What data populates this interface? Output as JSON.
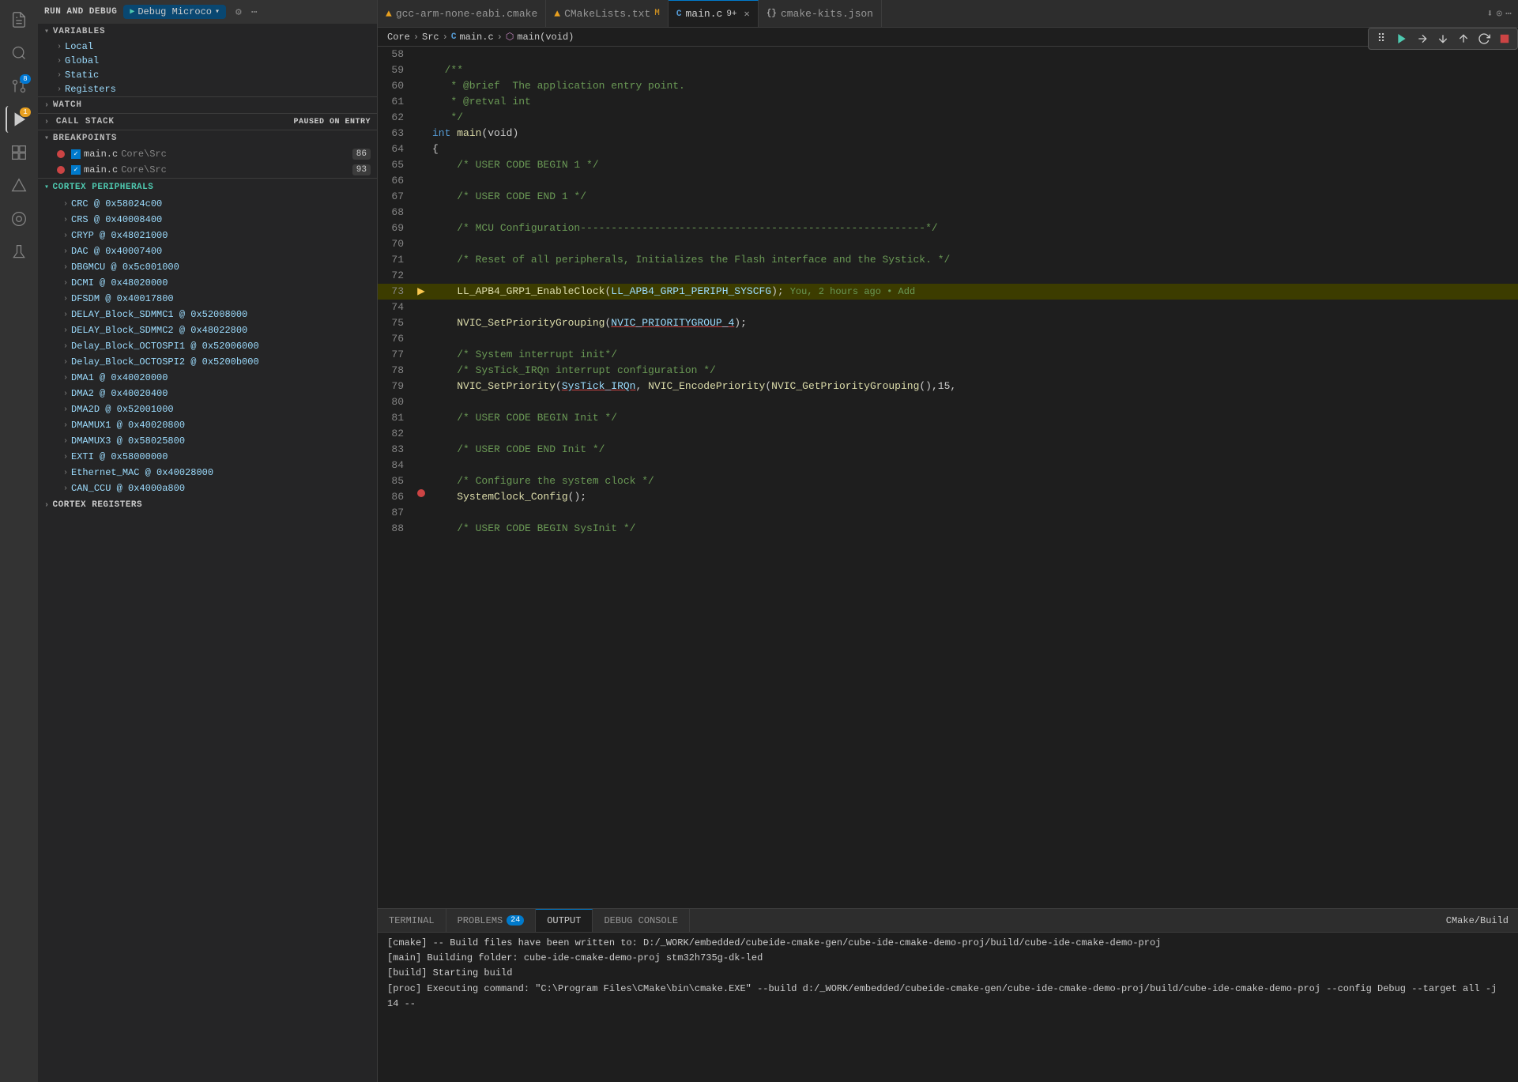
{
  "activityBar": {
    "icons": [
      {
        "name": "files-icon",
        "symbol": "⎗",
        "active": false
      },
      {
        "name": "search-icon",
        "symbol": "🔍",
        "active": false
      },
      {
        "name": "source-control-icon",
        "symbol": "⑂",
        "active": false,
        "badge": "8"
      },
      {
        "name": "run-debug-icon",
        "symbol": "▶",
        "active": true,
        "badge": "1",
        "badgeColor": "orange"
      },
      {
        "name": "extensions-icon",
        "symbol": "⊞",
        "active": false
      },
      {
        "name": "cmake-icon",
        "symbol": "◈",
        "active": false
      },
      {
        "name": "cortex-debug-icon",
        "symbol": "◉",
        "active": false
      },
      {
        "name": "testing-icon",
        "symbol": "🧪",
        "active": false
      }
    ]
  },
  "sidebar": {
    "title": "RUN AND DEBUG",
    "debugConfig": "Debug Microco",
    "sections": {
      "variables": {
        "label": "VARIABLES",
        "items": [
          "Local",
          "Global",
          "Static",
          "Registers"
        ]
      },
      "watch": {
        "label": "WATCH"
      },
      "callStack": {
        "label": "CALL STACK",
        "badge": "PAUSED ON ENTRY"
      },
      "breakpoints": {
        "label": "BREAKPOINTS",
        "items": [
          {
            "file": "main.c",
            "path": "Core\\Src",
            "line": 86
          },
          {
            "file": "main.c",
            "path": "Core\\Src",
            "line": 93
          }
        ]
      },
      "cortexPeripherals": {
        "label": "CORTEX PERIPHERALS",
        "items": [
          "CRC @ 0x58024c00",
          "CRS @ 0x40008400",
          "CRYP @ 0x48021000",
          "DAC @ 0x40007400",
          "DBGMCU @ 0x5c001000",
          "DCMI @ 0x48020000",
          "DFSDM @ 0x40017800",
          "DELAY_Block_SDMMC1 @ 0x52008000",
          "DELAY_Block_SDMMC2 @ 0x48022800",
          "Delay_Block_OCTOSPI1 @ 0x52006000",
          "Delay_Block_OCTOSPI2 @ 0x5200b000",
          "DMA1 @ 0x40020000",
          "DMA2 @ 0x40020400",
          "DMA2D @ 0x52001000",
          "DMAMUX1 @ 0x40020800",
          "DMAMUX3 @ 0x58025800",
          "EXTI @ 0x58000000",
          "Ethernet_MAC @ 0x40028000",
          "CAN_CCU @ 0x4000a800"
        ]
      },
      "cortexRegisters": {
        "label": "CORTEX REGISTERS"
      }
    }
  },
  "tabBar": {
    "tabs": [
      {
        "label": "gcc-arm-none-eabi.cmake",
        "icon": "cmake",
        "active": false
      },
      {
        "label": "CMakeLists.txt",
        "suffix": "M",
        "icon": "cmake",
        "active": false
      },
      {
        "label": "main.c",
        "suffix": "9+",
        "icon": "c",
        "active": true,
        "closeable": true
      },
      {
        "label": "cmake-kits.json",
        "icon": "json",
        "active": false
      }
    ],
    "actions": [
      "⬇",
      "⊙",
      "⋯"
    ]
  },
  "breadcrumb": {
    "parts": [
      "Core",
      ">",
      "Src",
      ">",
      "C  main.c",
      ">",
      "main(void)"
    ]
  },
  "debugToolbar": {
    "buttons": [
      {
        "name": "grid-icon",
        "symbol": "⠿",
        "color": "normal"
      },
      {
        "name": "continue-icon",
        "symbol": "⏵",
        "color": "green"
      },
      {
        "name": "step-over-icon",
        "symbol": "⤵",
        "color": "normal"
      },
      {
        "name": "step-into-icon",
        "symbol": "⬇",
        "color": "normal"
      },
      {
        "name": "step-out-icon",
        "symbol": "⬆",
        "color": "normal"
      },
      {
        "name": "restart-icon",
        "symbol": "↺",
        "color": "normal"
      },
      {
        "name": "stop-icon",
        "symbol": "⬛",
        "color": "normal"
      }
    ]
  },
  "codeLines": [
    {
      "num": 58,
      "code": "",
      "type": "empty"
    },
    {
      "num": 59,
      "code": "  /**",
      "type": "comment"
    },
    {
      "num": 60,
      "code": "   * @brief  The application entry point.",
      "type": "comment"
    },
    {
      "num": 61,
      "code": "   * @retval int",
      "type": "comment"
    },
    {
      "num": 62,
      "code": "   */",
      "type": "comment"
    },
    {
      "num": 63,
      "code": "  int main(void)",
      "type": "code_main"
    },
    {
      "num": 64,
      "code": "  {",
      "type": "code"
    },
    {
      "num": 65,
      "code": "    /* USER CODE BEGIN 1 */",
      "type": "comment_line"
    },
    {
      "num": 66,
      "code": "",
      "type": "empty"
    },
    {
      "num": 67,
      "code": "    /* USER CODE END 1 */",
      "type": "comment_line"
    },
    {
      "num": 68,
      "code": "",
      "type": "empty"
    },
    {
      "num": 69,
      "code": "    /* MCU Configuration----...*/",
      "type": "comment_line"
    },
    {
      "num": 70,
      "code": "",
      "type": "empty"
    },
    {
      "num": 71,
      "code": "    /* Reset of all peripherals, Initializes the Flash interface and the Systick. */",
      "type": "comment_line"
    },
    {
      "num": 72,
      "code": "",
      "type": "empty"
    },
    {
      "num": 73,
      "code": "    LL_APB4_GRP1_EnableClock(LL_APB4_GRP1_PERIPH_SYSCFG);",
      "type": "active_line",
      "git": "You, 2 hours ago • Add"
    },
    {
      "num": 74,
      "code": "",
      "type": "empty"
    },
    {
      "num": 75,
      "code": "    NVIC_SetPriorityGrouping(NVIC_PRIORITYGROUP_4);",
      "type": "code_underline"
    },
    {
      "num": 76,
      "code": "",
      "type": "empty"
    },
    {
      "num": 77,
      "code": "    /* System interrupt init*/",
      "type": "comment_line"
    },
    {
      "num": 78,
      "code": "    /* SysTick_IRQn interrupt configuration */",
      "type": "comment_line"
    },
    {
      "num": 79,
      "code": "    NVIC_SetPriority(SysTick_IRQn, NVIC_EncodePriority(NVIC_GetPriorityGrouping(),15,",
      "type": "code_underline2"
    },
    {
      "num": 80,
      "code": "",
      "type": "empty"
    },
    {
      "num": 81,
      "code": "    /* USER CODE BEGIN Init */",
      "type": "comment_line"
    },
    {
      "num": 82,
      "code": "",
      "type": "empty"
    },
    {
      "num": 83,
      "code": "    /* USER CODE END Init */",
      "type": "comment_line"
    },
    {
      "num": 84,
      "code": "",
      "type": "empty"
    },
    {
      "num": 85,
      "code": "    /* Configure the system clock */",
      "type": "comment_line"
    },
    {
      "num": 86,
      "code": "    SystemClock_Config();",
      "type": "bp_line"
    },
    {
      "num": 87,
      "code": "",
      "type": "empty"
    },
    {
      "num": 88,
      "code": "    /* USER CODE BEGIN SysInit */",
      "type": "comment_line"
    }
  ],
  "panel": {
    "tabs": [
      {
        "label": "TERMINAL",
        "active": false
      },
      {
        "label": "PROBLEMS",
        "badge": "24",
        "active": false
      },
      {
        "label": "OUTPUT",
        "active": true
      },
      {
        "label": "DEBUG CONSOLE",
        "active": false
      }
    ],
    "rightLabel": "CMake/Build",
    "lines": [
      "[cmake] -- Build files have been written to: D:/_WORK/embedded/cubeide-cmake-gen/cube-ide-...",
      "[main] Building folder: cube-ide-cmake-demo-proj stm32h735g-dk-led",
      "[build] Starting build",
      "[proc] Executing command: \"C:\\Program Files\\CMake\\bin\\cmake.EXE\" --build d:/_WORK/embedded..."
    ]
  }
}
